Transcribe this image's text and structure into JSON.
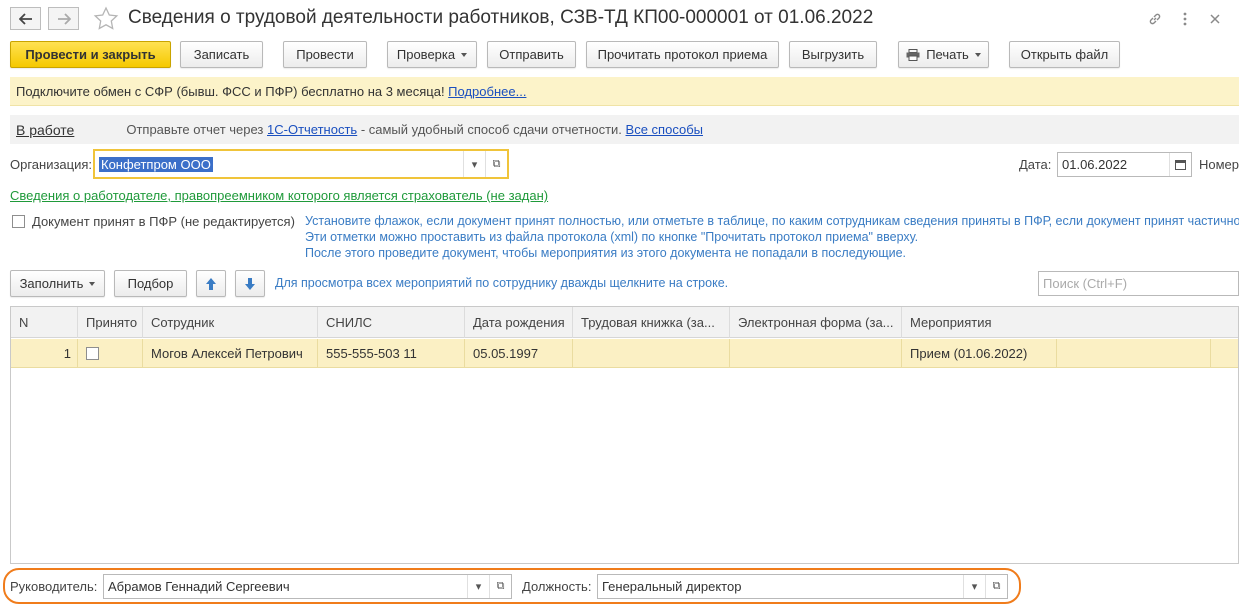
{
  "window": {
    "title": "Сведения о трудовой деятельности работников, СЗВ-ТД КП00-000001 от 01.06.2022"
  },
  "toolbar": {
    "post_close": "Провести и закрыть",
    "save": "Записать",
    "post": "Провести",
    "check": "Проверка",
    "send": "Отправить",
    "read_protocol": "Прочитать протокол приема",
    "export": "Выгрузить",
    "print": "Печать",
    "open_file": "Открыть файл"
  },
  "banner": {
    "text": "Подключите обмен с СФР (бывш. ФСС и ПФР) бесплатно на 3 месяца! ",
    "link": "Подробнее..."
  },
  "status": {
    "state": "В работе",
    "text_before": "Отправьте отчет через ",
    "link_1c": "1С-Отчетность",
    "text_after": " - самый удобный способ сдачи отчетности. ",
    "link_all": "Все способы"
  },
  "form": {
    "org_label": "Организация:",
    "org_value": "Конфетпром ООО",
    "date_label": "Дата:",
    "date_value": "01.06.2022",
    "number_label": "Номер",
    "employer_link": "Сведения о работодателе, правопреемником которого является страхователь (не задан)",
    "accepted_label": "Документ принят в ПФР (не редактируется)",
    "note_lines": [
      "Установите флажок, если документ принят полностью, или отметьте в таблице, по каким сотрудникам сведения приняты в ПФР, если документ принят частично.",
      "Эти отметки можно проставить из файла протокола (xml) по кнопке \"Прочитать протокол приема\" вверху.",
      "После этого проведите документ, чтобы мероприятия из этого документа не попадали в последующие."
    ]
  },
  "table_toolbar": {
    "fill": "Заполнить",
    "select": "Подбор",
    "hint": "Для просмотра всех мероприятий по сотруднику дважды щелкните на строке.",
    "search_placeholder": "Поиск (Ctrl+F)"
  },
  "table": {
    "columns": [
      "N",
      "Принято",
      "Сотрудник",
      "СНИЛС",
      "Дата рождения",
      "Трудовая книжка (за...",
      "Электронная форма (за...",
      "Мероприятия"
    ],
    "rows": [
      {
        "n": "1",
        "accepted": false,
        "employee": "Могов Алексей Петрович",
        "snils": "555-555-503 11",
        "birth": "05.05.1997",
        "book": "",
        "eform": "",
        "events": "Прием (01.06.2022)"
      }
    ]
  },
  "footer": {
    "head_label": "Руководитель:",
    "head_value": "Абрамов Геннадий Сергеевич",
    "position_label": "Должность:",
    "position_value": "Генеральный директор"
  }
}
